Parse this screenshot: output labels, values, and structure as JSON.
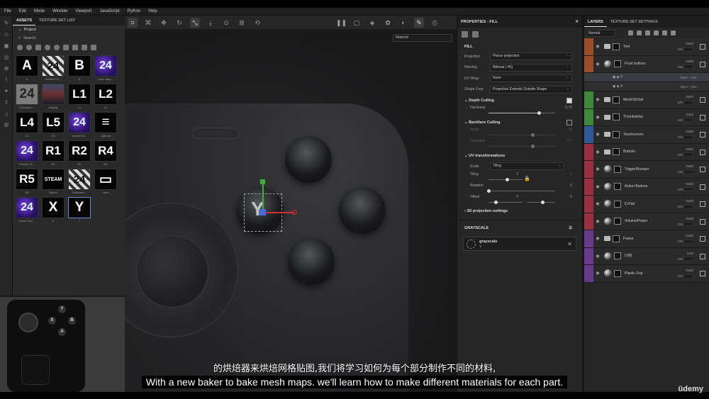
{
  "menu": [
    "File",
    "Edit",
    "Mode",
    "Window",
    "Viewport",
    "JavaScript",
    "Python",
    "Help"
  ],
  "assets": {
    "tabs": [
      "ASSETS",
      "TEXTURE SET LIST"
    ],
    "project_label": "Project",
    "search_placeholder": "Search",
    "items": [
      {
        "glyph": "A",
        "caption": "A",
        "style": ""
      },
      {
        "glyph": "24",
        "caption": "Ambient O...",
        "style": "checker"
      },
      {
        "glyph": "B",
        "caption": "B",
        "style": ""
      },
      {
        "glyph": "24",
        "caption": "Color Map...",
        "style": "purple"
      },
      {
        "glyph": "24",
        "caption": "Curvature ...",
        "style": "gray"
      },
      {
        "glyph": "",
        "caption": "Display",
        "style": "photo"
      },
      {
        "glyph": "L1",
        "caption": "L1",
        "style": ""
      },
      {
        "glyph": "L2",
        "caption": "L2",
        "style": ""
      },
      {
        "glyph": "L4",
        "caption": "L4",
        "style": ""
      },
      {
        "glyph": "L5",
        "caption": "L5",
        "style": ""
      },
      {
        "glyph": "24",
        "caption": "Normal M...",
        "style": "purple"
      },
      {
        "glyph": "≡",
        "caption": "Options",
        "style": ""
      },
      {
        "glyph": "24",
        "caption": "Position S...",
        "style": "purple"
      },
      {
        "glyph": "R1",
        "caption": "R1",
        "style": ""
      },
      {
        "glyph": "R2",
        "caption": "R2",
        "style": ""
      },
      {
        "glyph": "R4",
        "caption": "R4",
        "style": ""
      },
      {
        "glyph": "R5",
        "caption": "R5",
        "style": ""
      },
      {
        "glyph": "STEAM",
        "caption": "Steam",
        "style": "steam"
      },
      {
        "glyph": "24",
        "caption": "Thickness ...",
        "style": "checker"
      },
      {
        "glyph": "▭",
        "caption": "View",
        "style": ""
      },
      {
        "glyph": "24",
        "caption": "World Spa...",
        "style": "purple"
      },
      {
        "glyph": "X",
        "caption": "X",
        "style": ""
      },
      {
        "glyph": "Y",
        "caption": "Y",
        "style": "sel"
      }
    ]
  },
  "preview": {
    "buttons": [
      "Y",
      "X",
      "B",
      "A"
    ]
  },
  "viewport": {
    "material_dropdown": "Material",
    "gizmo_label": "Y"
  },
  "properties": {
    "title": "PROPERTIES - FILL",
    "fill_section": "FILL",
    "rows": [
      {
        "label": "Projection",
        "value": "Planar projection"
      },
      {
        "label": "Filtering",
        "value": "Bilinear | HQ"
      },
      {
        "label": "UV Wrap",
        "value": "None"
      },
      {
        "label": "Shape Crop",
        "value": "Projection Extends Outside Shape"
      }
    ],
    "depth_culling": {
      "label": "Depth Culling",
      "checked": true,
      "hardness_label": "Hardness",
      "hardness_value": "0.75",
      "hardness": 0.75
    },
    "backface_culling": {
      "label": "Backface Culling",
      "checked": false,
      "angle_label": "Angle",
      "angle_value": "90",
      "hardness_label": "Hardness",
      "hardness_value": "0.2"
    },
    "uv": {
      "label": "UV transformations",
      "scale_label": "Scale",
      "scale_value": "Tiling",
      "tiling_label": "Tiling",
      "tiling_value": "1",
      "tiling_value2": "1",
      "rotation_label": "Rotation",
      "rotation_value": "0",
      "offset_label": "Offset",
      "offset_value": "0",
      "offset_value2": "0"
    },
    "projection_3d": "3D projection settings",
    "grayscale": {
      "section": "GRAYSCALE",
      "name": "grayscale",
      "sub": "Y"
    }
  },
  "layers": {
    "tabs": [
      "LAYERS",
      "TEXTURE SET SETTINGS"
    ],
    "blend_mode": "Normal",
    "items": [
      {
        "name": "Text",
        "color": "#9a4f2a",
        "type": "folder",
        "blend": "NMdt",
        "opacity": "100"
      },
      {
        "name": "Front buttons",
        "color": "#9a4f2a",
        "type": "sphere",
        "blend": "NMdt",
        "opacity": "100"
      },
      {
        "name": "Mesh/Sl/Usb",
        "color": "#3f8a3a",
        "type": "folder",
        "blend": "NMdt",
        "opacity": "100"
      },
      {
        "name": "Thumbsticks",
        "color": "#3f8a3a",
        "type": "folder",
        "blend": "NMdt",
        "opacity": "100"
      },
      {
        "name": "Touchscreen",
        "color": "#2f5a9a",
        "type": "folder",
        "blend": "NMdt",
        "opacity": "100"
      },
      {
        "name": "Buttons",
        "color": "#9a3040",
        "type": "folder",
        "blend": "NMdt",
        "opacity": "100"
      },
      {
        "name": "Trigger/Bumper",
        "color": "#9a3040",
        "type": "sphere",
        "blend": "NMdt",
        "opacity": "100"
      },
      {
        "name": "Action Buttons",
        "color": "#9a3040",
        "type": "sphere",
        "blend": "NMdt",
        "opacity": "100"
      },
      {
        "name": "D-Pad",
        "color": "#9a3040",
        "type": "sphere",
        "blend": "NMdt",
        "opacity": "100"
      },
      {
        "name": "Volume/Power",
        "color": "#9a3040",
        "type": "sphere",
        "blend": "NMdt",
        "opacity": "100"
      },
      {
        "name": "Frame",
        "color": "#6a3a8a",
        "type": "folder",
        "blend": "NMdt",
        "opacity": "100"
      },
      {
        "name": "USB",
        "color": "#6a3a8a",
        "type": "sphere",
        "blend": "Repl",
        "opacity": "100"
      },
      {
        "name": "Plastic Grip",
        "color": "#6a3a8a",
        "type": "sphere",
        "blend": "NMdt",
        "opacity": "100"
      }
    ],
    "sublayers": [
      {
        "name": "Y",
        "blend": "Norm",
        "opacity": "100"
      },
      {
        "name": "X",
        "blend": "Norm",
        "opacity": "100"
      }
    ]
  },
  "subtitles": {
    "zh": "的烘焙器来烘焙网格贴图,我们将学习如何为每个部分制作不同的材料,",
    "en": "With a new baker to bake mesh maps. we'll learn how to make different materials for each part."
  },
  "watermark": "ūdemy"
}
